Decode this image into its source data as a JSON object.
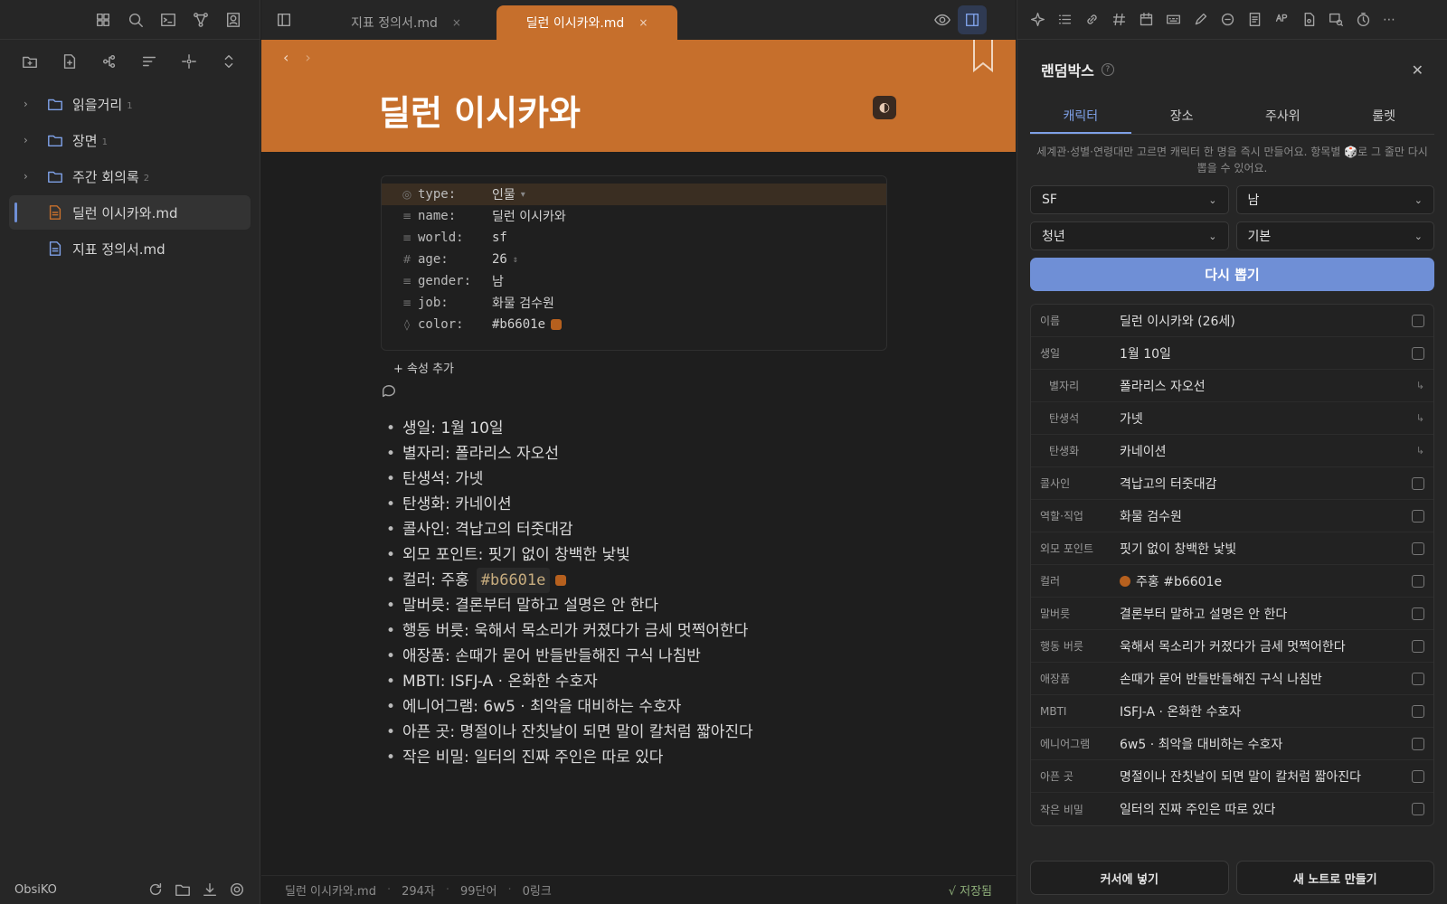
{
  "left": {
    "tree": [
      {
        "label": "읽을거리",
        "count": "1",
        "type": "folder"
      },
      {
        "label": "장면",
        "count": "1",
        "type": "folder"
      },
      {
        "label": "주간 회의록",
        "count": "2",
        "type": "folder"
      },
      {
        "label": "딜런 이시카와.md",
        "type": "file-active"
      },
      {
        "label": "지표 정의서.md",
        "type": "file"
      }
    ],
    "vault_name": "ObsiKO"
  },
  "tabs": [
    {
      "label": "지표 정의서.md",
      "active": false
    },
    {
      "label": "딜런 이시카와.md",
      "active": true
    }
  ],
  "note": {
    "title": "딜런 이시카와",
    "properties": {
      "type": {
        "key": "type:",
        "value": "인물"
      },
      "name": {
        "key": "name:",
        "value": "딜런 이시카와"
      },
      "world": {
        "key": "world:",
        "value": "sf"
      },
      "age": {
        "key": "age:",
        "value": "26"
      },
      "gender": {
        "key": "gender:",
        "value": "남"
      },
      "job": {
        "key": "job:",
        "value": "화물 검수원"
      },
      "color": {
        "key": "color:",
        "value": "#b6601e"
      }
    },
    "add_property": "+ 속성 추가",
    "body": [
      "생일: 1월 10일",
      "별자리: 폴라리스 자오선",
      "탄생석: 가넷",
      "탄생화: 카네이션",
      "콜사인: 격납고의 터줏대감",
      "외모 포인트: 핏기 없이 창백한 낯빛",
      "컬러: 주홍",
      "말버릇: 결론부터 말하고 설명은 안 한다",
      "행동 버릇: 욱해서 목소리가 커졌다가 금세 멋쩍어한다",
      "애장품: 손때가 묻어 반들반들해진 구식 나침반",
      "MBTI: ISFJ-A · 온화한 수호자",
      "에니어그램: 6w5 · 최악을 대비하는 수호자",
      "아픈 곳: 명절이나 잔칫날이 되면 말이 칼처럼 짧아진다",
      "작은 비밀: 일터의 진짜 주인은 따로 있다"
    ],
    "color_chip": "#b6601e"
  },
  "status": {
    "file": "딜런 이시카와.md",
    "chars": "294자",
    "words": "99단어",
    "links": "0링크",
    "saved": "√ 저장됨"
  },
  "randombox": {
    "title": "랜덤박스",
    "tabs": [
      "캐릭터",
      "장소",
      "주사위",
      "룰렛"
    ],
    "description": "세계관·성별·연령대만 고르면 캐릭터 한 명을 즉시 만들어요. 항목별 🎲로 그 줄만 다시 뽑을 수 있어요.",
    "selects": {
      "world": "SF",
      "gender": "남",
      "age": "청년",
      "style": "기본"
    },
    "reroll": "다시 뽑기",
    "rows": [
      {
        "k": "이름",
        "v": "딜런 이시카와 (26세)"
      },
      {
        "k": "생일",
        "v": "1월 10일"
      },
      {
        "k": "별자리",
        "v": "폴라리스 자오선",
        "sub": true
      },
      {
        "k": "탄생석",
        "v": "가넷",
        "sub": true
      },
      {
        "k": "탄생화",
        "v": "카네이션",
        "sub": true
      },
      {
        "k": "콜사인",
        "v": "격납고의 터줏대감"
      },
      {
        "k": "역할·직업",
        "v": "화물 검수원"
      },
      {
        "k": "외모 포인트",
        "v": "핏기 없이 창백한 낯빛"
      },
      {
        "k": "컬러",
        "v": "주홍 #b6601e",
        "dot": true
      },
      {
        "k": "말버릇",
        "v": "결론부터 말하고 설명은 안 한다"
      },
      {
        "k": "행동 버릇",
        "v": "욱해서 목소리가 커졌다가 금세 멋쩍어한다"
      },
      {
        "k": "애장품",
        "v": "손때가 묻어 반들반들해진 구식 나침반"
      },
      {
        "k": "MBTI",
        "v": "ISFJ-A · 온화한 수호자"
      },
      {
        "k": "에니어그램",
        "v": "6w5 · 최악을 대비하는 수호자"
      },
      {
        "k": "아픈 곳",
        "v": "명절이나 잔칫날이 되면 말이 칼처럼 짧아진다"
      },
      {
        "k": "작은 비밀",
        "v": "일터의 진짜 주인은 따로 있다"
      }
    ],
    "actions": {
      "insert": "커서에 넣기",
      "new_note": "새 노트로 만들기"
    }
  },
  "colors": {
    "accent": "#c66f2c",
    "blue": "#6f8fd6",
    "character": "#b6601e"
  }
}
